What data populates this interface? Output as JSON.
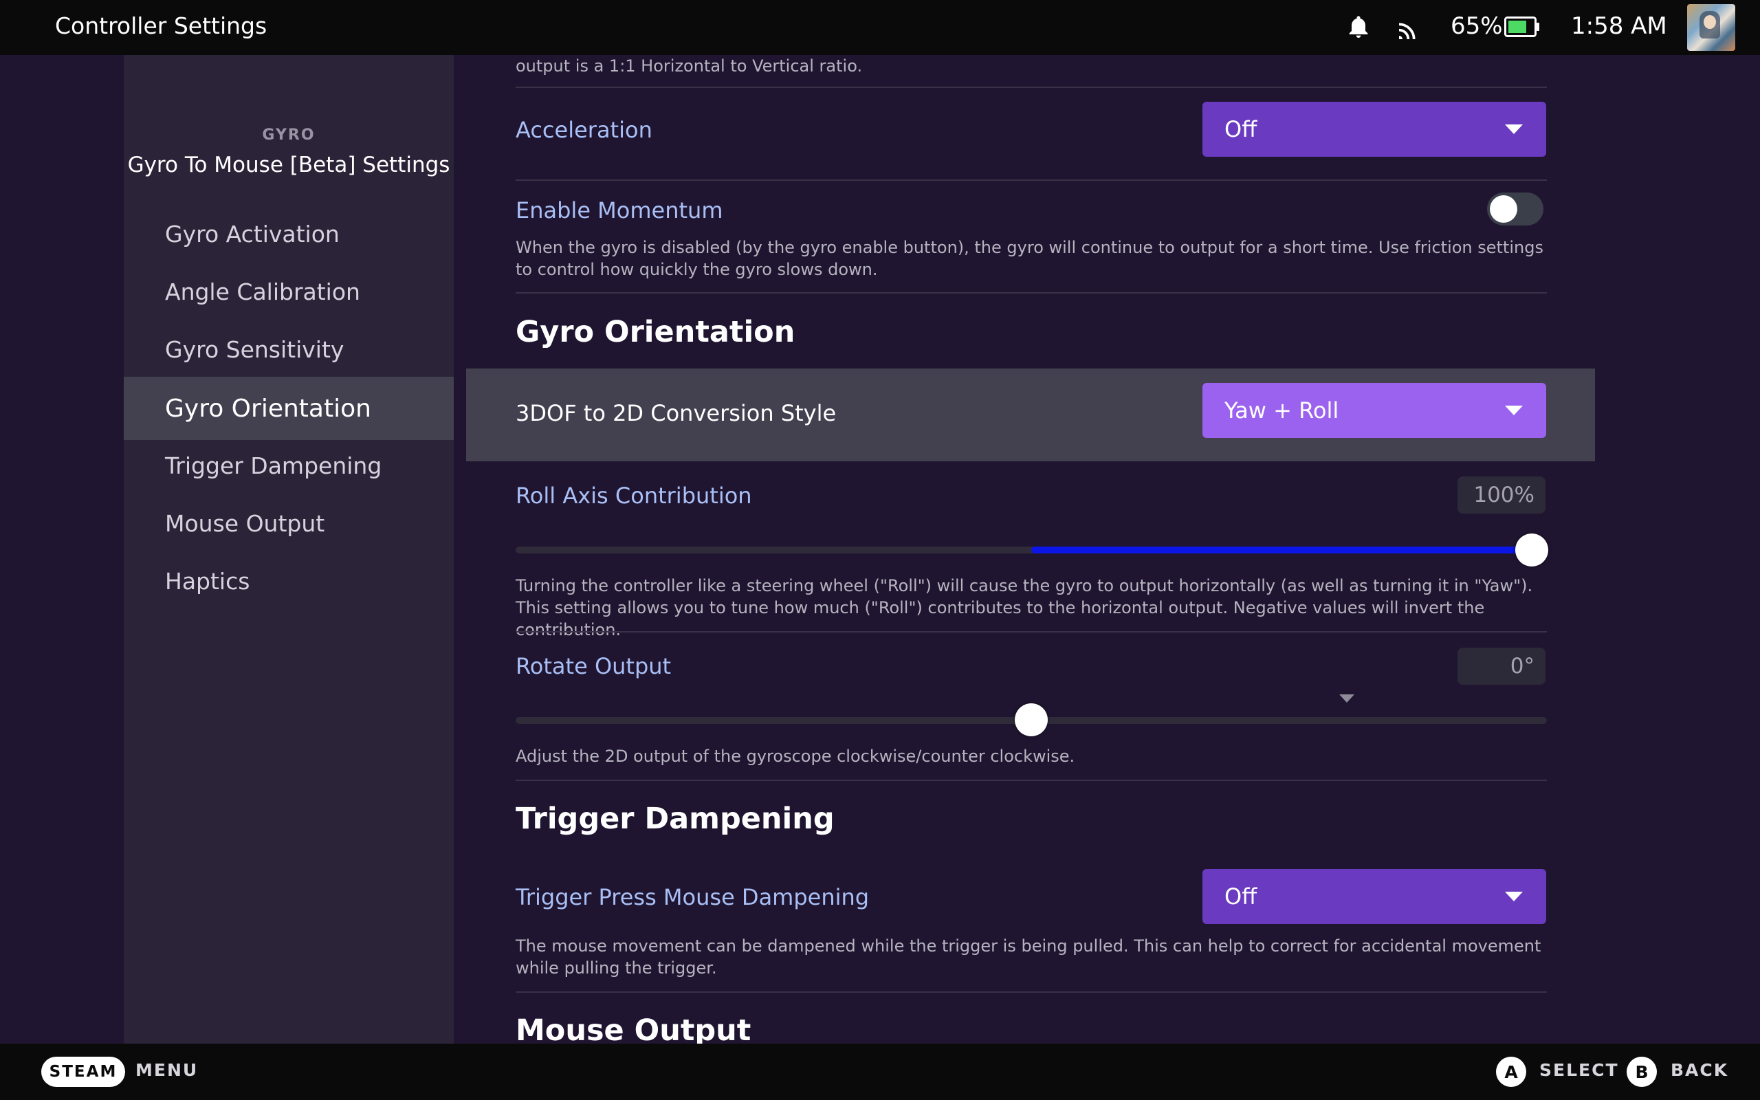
{
  "header": {
    "title": "Controller Settings",
    "battery_pct": "65%",
    "time": "1:58 AM"
  },
  "sidebar": {
    "section": "GYRO",
    "title": "Gyro To Mouse [Beta] Settings",
    "items": [
      {
        "label": "Gyro Activation"
      },
      {
        "label": "Angle Calibration"
      },
      {
        "label": "Gyro Sensitivity"
      },
      {
        "label": "Gyro Orientation",
        "active": true
      },
      {
        "label": "Trigger Dampening"
      },
      {
        "label": "Mouse Output"
      },
      {
        "label": "Haptics"
      }
    ]
  },
  "main": {
    "top_desc": "output is a 1:1 Horizontal to Vertical ratio.",
    "acceleration": {
      "label": "Acceleration",
      "value": "Off"
    },
    "momentum": {
      "label": "Enable Momentum",
      "enabled": false,
      "desc": "When the gyro is disabled (by the gyro enable button), the gyro will continue to output for a short time. Use friction settings to control how quickly the gyro slows down."
    },
    "gyro_orientation": {
      "heading": "Gyro Orientation",
      "conversion": {
        "label": "3DOF to 2D Conversion Style",
        "value": "Yaw + Roll"
      },
      "roll": {
        "label": "Roll Axis Contribution",
        "value": "100%",
        "slider_fraction": 1.0,
        "desc": "Turning the controller like a steering wheel (\"Roll\") will cause the gyro to output horizontally (as well as turning it in \"Yaw\"). This setting allows you to tune how much (\"Roll\") contributes to the horizontal output. Negative values will invert the contribution."
      },
      "rotate": {
        "label": "Rotate Output",
        "value": "0°",
        "slider_fraction": 0.5,
        "desc": "Adjust the 2D output of the gyroscope clockwise/counter clockwise."
      }
    },
    "trigger_dampening": {
      "heading": "Trigger Dampening",
      "press": {
        "label": "Trigger Press Mouse Dampening",
        "value": "Off",
        "desc": "The mouse movement can be dampened while the trigger is being pulled. This can help to correct for accidental movement while pulling the trigger."
      }
    },
    "mouse_output_heading": "Mouse Output"
  },
  "footer": {
    "steam": "STEAM",
    "menu": "MENU",
    "a": "A",
    "select": "SELECT",
    "b": "B",
    "back": "BACK"
  },
  "colors": {
    "accent_dropdown": "#6a3bc0",
    "accent_dropdown_focused": "#9b62ef",
    "slider_fill": "#0b16e6",
    "label_blue": "#a9bff5"
  }
}
